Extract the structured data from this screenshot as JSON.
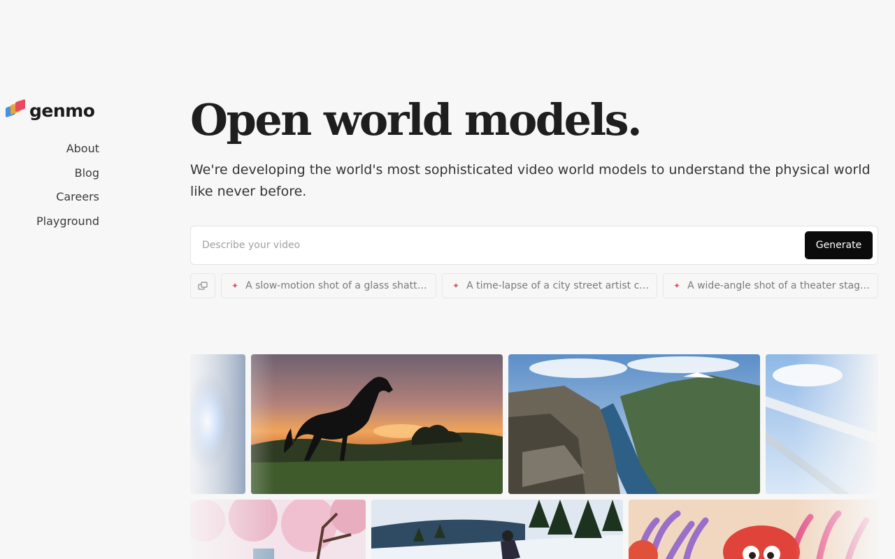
{
  "brand": {
    "name": "genmo",
    "colors": {
      "red": "#e84a5f",
      "orange": "#f6a623",
      "blue": "#4a90e2"
    }
  },
  "nav": {
    "items": [
      "About",
      "Blog",
      "Careers",
      "Playground"
    ]
  },
  "hero": {
    "title": "Open world models.",
    "subtitle": "We're developing the world's most sophisticated video world models to understand the physical world like never before."
  },
  "prompt": {
    "placeholder": "Describe your video",
    "value": "",
    "generate_label": "Generate"
  },
  "suggestions": {
    "shuffle_icon": "shuffle-icon",
    "items": [
      "A slow-motion shot of a glass shatt…",
      "A time-lapse of a city street artist c…",
      "A wide-angle shot of a theater stag…"
    ]
  },
  "gallery": {
    "items": [
      "partial-left-glow",
      "horse-sunset",
      "fjord-cliffs",
      "airplane-wing-sky",
      "cherry-blossom",
      "skier-forest",
      "coral-reef-fish"
    ]
  }
}
